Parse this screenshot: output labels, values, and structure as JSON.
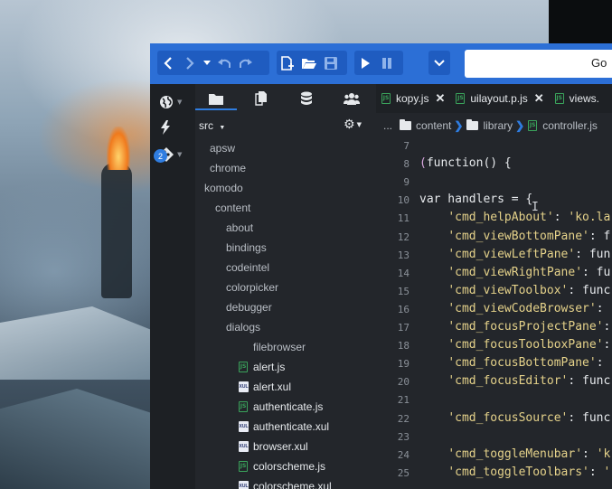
{
  "toolbar": {
    "nav_icons": [
      "chevron-left-icon",
      "chevron-right-icon",
      "chevron-down-icon",
      "undo-icon",
      "redo-icon"
    ],
    "file_icons": [
      "new-file-icon",
      "open-folder-icon",
      "save-icon"
    ],
    "run_icons": [
      "play-icon",
      "pause-icon"
    ],
    "go_label": "Go"
  },
  "rail": {
    "badge_count": "2"
  },
  "pane_tabs": [
    "folder-icon",
    "file-icon",
    "database-icon",
    "users-icon"
  ],
  "file_tabs": [
    {
      "name": "kopy.js",
      "type": "js"
    },
    {
      "name": "uilayout.p.js",
      "type": "js"
    },
    {
      "name": "views.",
      "type": "js"
    }
  ],
  "tree": {
    "root_label": "src",
    "nodes": [
      {
        "label": "apsw",
        "depth": 0,
        "kind": "folder"
      },
      {
        "label": "chrome",
        "depth": 0,
        "kind": "folder"
      },
      {
        "label": "komodo",
        "depth": 1,
        "kind": "folder"
      },
      {
        "label": "content",
        "depth": 2,
        "kind": "folder"
      },
      {
        "label": "about",
        "depth": 3,
        "kind": "folder"
      },
      {
        "label": "bindings",
        "depth": 3,
        "kind": "folder"
      },
      {
        "label": "codeintel",
        "depth": 3,
        "kind": "folder"
      },
      {
        "label": "colorpicker",
        "depth": 3,
        "kind": "folder"
      },
      {
        "label": "debugger",
        "depth": 3,
        "kind": "folder"
      },
      {
        "label": "dialogs",
        "depth": 3,
        "kind": "folder"
      },
      {
        "label": "filebrowser",
        "depth": 4,
        "kind": "folder"
      },
      {
        "label": "alert.js",
        "depth": 3,
        "kind": "js"
      },
      {
        "label": "alert.xul",
        "depth": 3,
        "kind": "xul"
      },
      {
        "label": "authenticate.js",
        "depth": 3,
        "kind": "js"
      },
      {
        "label": "authenticate.xul",
        "depth": 3,
        "kind": "xul"
      },
      {
        "label": "browser.xul",
        "depth": 3,
        "kind": "xul"
      },
      {
        "label": "colorscheme.js",
        "depth": 3,
        "kind": "js"
      },
      {
        "label": "colorscheme.xul",
        "depth": 3,
        "kind": "xul"
      }
    ]
  },
  "breadcrumb": {
    "ellipsis": "...",
    "items": [
      "content",
      "library",
      "controller.js"
    ]
  },
  "editor": {
    "lines": [
      {
        "n": "7",
        "text": ""
      },
      {
        "n": "8",
        "text": "(function() {"
      },
      {
        "n": "9",
        "text": ""
      },
      {
        "n": "10",
        "text": "var handlers = {"
      },
      {
        "n": "11",
        "text": "    'cmd_helpAbout': 'ko.la"
      },
      {
        "n": "12",
        "text": "    'cmd_viewBottomPane': f"
      },
      {
        "n": "13",
        "text": "    'cmd_viewLeftPane': fun"
      },
      {
        "n": "14",
        "text": "    'cmd_viewRightPane': fu"
      },
      {
        "n": "15",
        "text": "    'cmd_viewToolbox': func"
      },
      {
        "n": "16",
        "text": "    'cmd_viewCodeBrowser': "
      },
      {
        "n": "17",
        "text": "    'cmd_focusProjectPane':"
      },
      {
        "n": "18",
        "text": "    'cmd_focusToolboxPane':"
      },
      {
        "n": "19",
        "text": "    'cmd_focusBottomPane': "
      },
      {
        "n": "20",
        "text": "    'cmd_focusEditor': func"
      },
      {
        "n": "21",
        "text": ""
      },
      {
        "n": "22",
        "text": "    'cmd_focusSource': func"
      },
      {
        "n": "23",
        "text": ""
      },
      {
        "n": "24",
        "text": "    'cmd_toggleMenubar': 'k"
      },
      {
        "n": "25",
        "text": "    'cmd_toggleToolbars': '"
      }
    ]
  }
}
